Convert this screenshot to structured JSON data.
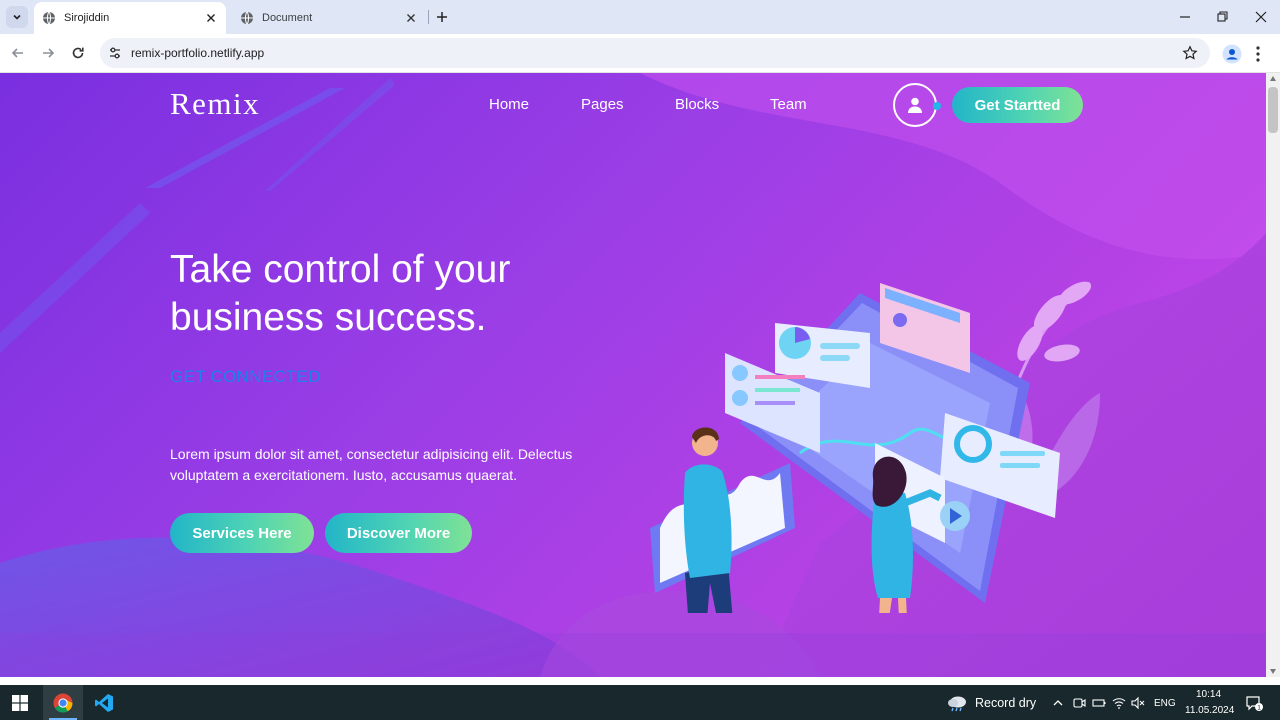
{
  "browser": {
    "tabs": [
      {
        "title": "Sirojiddin",
        "active": true
      },
      {
        "title": "Document",
        "active": false
      }
    ],
    "address": "remix-portfolio.netlify.app"
  },
  "site": {
    "logo": "Remix",
    "nav": [
      "Home",
      "Pages",
      "Blocks",
      "Team"
    ],
    "cta": "Get Startted",
    "hero": {
      "title": "Take control of your business success.",
      "tagline": "GET CONNECTED",
      "text": "Lorem ipsum dolor sit amet, consectetur adipisicing elit. Delectus voluptatem a exercitationem. Iusto, accusamus quaerat.",
      "buttons": [
        "Services Here",
        "Discover More"
      ]
    },
    "colors": {
      "bg_start": "#7a2fe0",
      "bg_end": "#d34ef0",
      "button_gradient_start": "#22b5c8",
      "button_gradient_end": "#7fe295",
      "tagline": "#1b82e8"
    }
  },
  "taskbar": {
    "weather": "Record dry",
    "lang": "ENG",
    "time": "10:14",
    "date": "11.05.2024",
    "notification_count": "1",
    "apps": [
      "chrome-icon",
      "vscode-icon"
    ]
  }
}
